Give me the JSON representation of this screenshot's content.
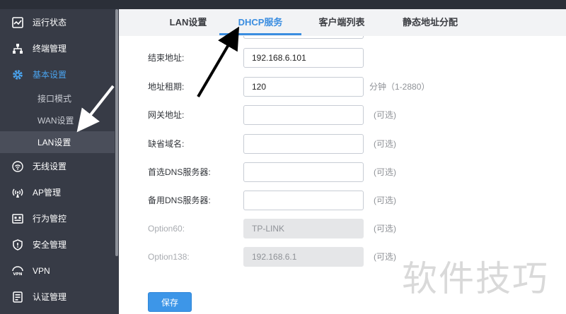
{
  "sidebar": {
    "items": [
      {
        "label": "运行状态",
        "icon": "chart-icon"
      },
      {
        "label": "终端管理",
        "icon": "network-tree-icon"
      },
      {
        "label": "基本设置",
        "icon": "gear-icon"
      },
      {
        "label": "无线设置",
        "icon": "wifi-icon"
      },
      {
        "label": "AP管理",
        "icon": "ap-antenna-icon"
      },
      {
        "label": "行为管控",
        "icon": "control-panel-icon"
      },
      {
        "label": "安全管理",
        "icon": "shield-icon"
      },
      {
        "label": "VPN",
        "icon": "vpn-icon"
      },
      {
        "label": "认证管理",
        "icon": "auth-card-icon"
      }
    ],
    "sub_items": [
      {
        "label": "接口模式"
      },
      {
        "label": "WAN设置"
      },
      {
        "label": "LAN设置"
      }
    ]
  },
  "tabs": [
    {
      "label": "LAN设置"
    },
    {
      "label": "DHCP服务"
    },
    {
      "label": "客户端列表"
    },
    {
      "label": "静态地址分配"
    }
  ],
  "form": {
    "end_address": {
      "label": "结束地址:",
      "value": "192.168.6.101"
    },
    "lease_time": {
      "label": "地址租期:",
      "value": "120",
      "hint": "分钟（1-2880）"
    },
    "gateway": {
      "label": "网关地址:",
      "value": "",
      "hint": "(可选)"
    },
    "default_domain": {
      "label": "缺省域名:",
      "value": "",
      "hint": "(可选)"
    },
    "primary_dns": {
      "label": "首选DNS服务器:",
      "value": "",
      "hint": "(可选)"
    },
    "secondary_dns": {
      "label": "备用DNS服务器:",
      "value": "",
      "hint": "(可选)"
    },
    "option60": {
      "label": "Option60:",
      "value": "TP-LINK",
      "hint": "(可选)"
    },
    "option138": {
      "label": "Option138:",
      "value": "192.168.6.1",
      "hint": "(可选)"
    }
  },
  "save_label": "保存",
  "watermark": "软件技巧",
  "colors": {
    "sidebar_bg": "#373b46",
    "accent": "#3a8de0",
    "save_button": "#3d96e8"
  }
}
